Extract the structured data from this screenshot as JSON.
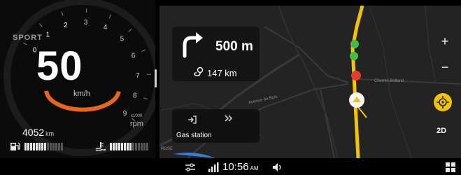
{
  "cluster": {
    "drive_mode": "SPORT",
    "speed": "50",
    "speed_unit": "km/h",
    "gauge_marks": [
      "0",
      "1",
      "2",
      "3",
      "4",
      "5",
      "6",
      "7",
      "8",
      "9"
    ],
    "rpm_multiplier": "x1000",
    "rpm_unit": "rpm",
    "rpm_level": 0.45,
    "odometer": "4052",
    "odometer_unit": "km",
    "fuel_icon": "fuel-pump-icon",
    "fuel_level": 0.55,
    "temp_icon": "coolant-temperature-icon",
    "temp_level": 0.6,
    "accent": "#e8651c"
  },
  "navigation": {
    "turn_icon": "turn-right-arrow-icon",
    "next_turn_distance": "500 m",
    "route_icon": "route-pin-icon",
    "remaining_distance": "147 km",
    "poi_icon": "poi-entry-icon",
    "poi_more_icon": "chevron-double-right-icon",
    "poi_label": "Gas station",
    "streets": [
      "Chemin Bolland",
      "Avenue du Bois",
      "ROSE"
    ],
    "route_color": "#f2c300",
    "traffic_colors": [
      "#3fbf4a",
      "#3fbf4a",
      "#e53a2c"
    ]
  },
  "map_controls": {
    "zoom_in": "+",
    "zoom_out": "−",
    "locate_icon": "crosshair-icon",
    "view_mode": "2D"
  },
  "status_bar": {
    "settings_icon": "sliders-icon",
    "signal_icon": "signal-bars-icon",
    "time": "10:56",
    "ampm": "AM",
    "volume_icon": "speaker-icon",
    "apps_icon": "app-grid-icon"
  }
}
